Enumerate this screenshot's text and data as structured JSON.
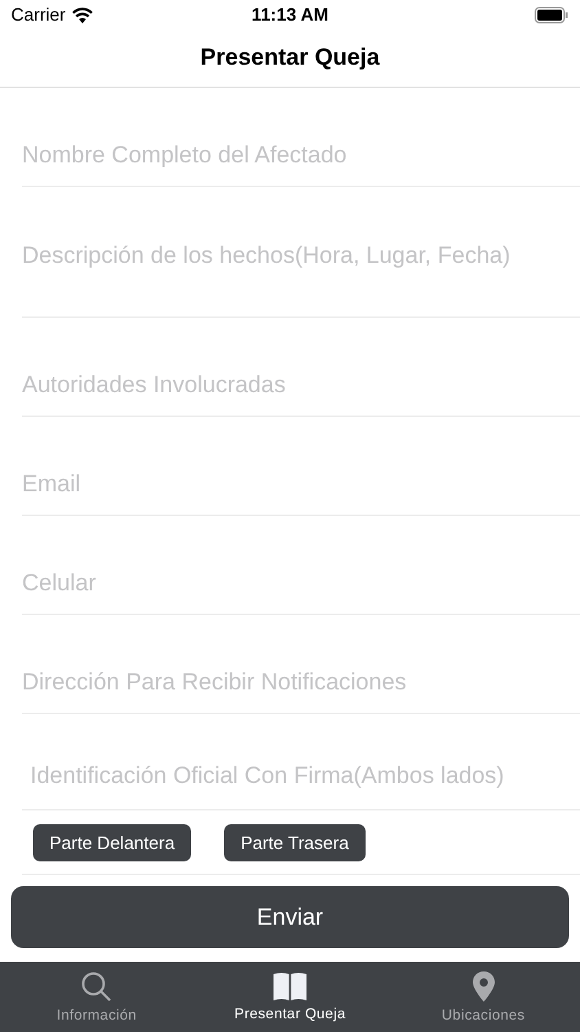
{
  "status_bar": {
    "carrier": "Carrier",
    "time": "11:13 AM"
  },
  "nav": {
    "title": "Presentar Queja"
  },
  "fields": [
    {
      "kind": "line",
      "placeholder": "Nombre Completo del Afectado"
    },
    {
      "kind": "area",
      "placeholder": "Descripción de los hechos(Hora, Lugar, Fecha)"
    },
    {
      "kind": "line",
      "placeholder": "Autoridades Involucradas"
    },
    {
      "kind": "line",
      "placeholder": "Email"
    },
    {
      "kind": "line",
      "placeholder": "Celular"
    },
    {
      "kind": "line",
      "placeholder": "Dirección Para Recibir Notificaciones"
    }
  ],
  "id_section": {
    "label": "Identificación Oficial Con Firma(Ambos lados)",
    "buttons": [
      "Parte Delantera",
      "Parte Trasera"
    ]
  },
  "submit": "Enviar",
  "tabs": [
    {
      "label": "Información",
      "kind": "search",
      "selected": false
    },
    {
      "label": "Presentar Queja",
      "kind": "book",
      "selected": true
    },
    {
      "label": "Ubicaciones",
      "kind": "pin",
      "selected": false
    }
  ]
}
